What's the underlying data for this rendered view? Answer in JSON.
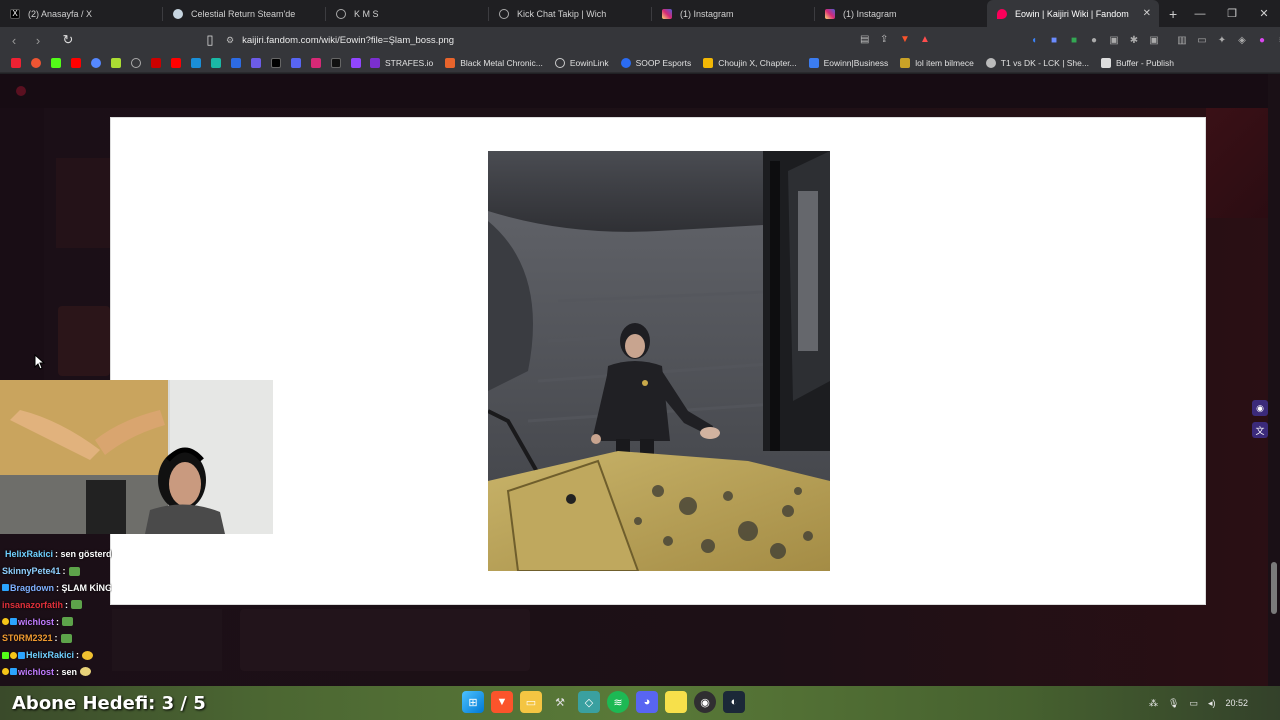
{
  "browser": {
    "tabs": [
      {
        "label": "(2) Anasayfa / X",
        "icon": "x-logo-icon",
        "color": "#000000"
      },
      {
        "label": "Celestial Return Steam'de",
        "icon": "steam-icon",
        "color": "#1b2838"
      },
      {
        "label": "K M S",
        "icon": "globe-icon",
        "color": "#888888"
      },
      {
        "label": "Kick Chat Takip | Wich",
        "icon": "globe-icon",
        "color": "#888888"
      },
      {
        "label": "(1) Instagram",
        "icon": "instagram-icon",
        "color": "#d6249f"
      },
      {
        "label": "(1) Instagram",
        "icon": "instagram-icon",
        "color": "#d6249f"
      },
      {
        "label": "Eowin | Kaijiri Wiki | Fandom",
        "icon": "fandom-icon",
        "color": "#fa005a",
        "active": true
      }
    ],
    "new_tab_glyph": "+",
    "address": "kaijiri.fandom.com/wiki/Eowin?file=Şlam_boss.png",
    "bookmarks": [
      {
        "label": "STRAFES.io",
        "color": "#7b2fd0"
      },
      {
        "label": "Black Metal Chronic...",
        "color": "#e8642c"
      },
      {
        "label": "EowinLink",
        "color": "#cccccc"
      },
      {
        "label": "SOOP Esports",
        "color": "#2b6cf2"
      },
      {
        "label": "Choujin X, Chapter...",
        "color": "#f2b705"
      },
      {
        "label": "Eowinn|Business",
        "color": "#3b7cf0"
      },
      {
        "label": "lol item bilmece",
        "color": "#c9a227"
      },
      {
        "label": "T1 vs DK - LCK | She...",
        "color": "#cccccc"
      },
      {
        "label": "Buffer - Publish",
        "color": "#dddddd"
      }
    ]
  },
  "chat": {
    "lines": [
      {
        "user": "HelixRakici",
        "user_color": "#6fd0ff",
        "message": ": sen gösterdin"
      },
      {
        "user": "SkinnyPete41",
        "user_color": "#8fd0ff",
        "message": ":"
      },
      {
        "user": "Bragdown",
        "user_color": "#7fb0ff",
        "message": ": ŞLAM KİNG"
      },
      {
        "user": "insanazorfatih",
        "user_color": "#e0303a",
        "message": ":"
      },
      {
        "user": "wichlost",
        "user_color": "#c07bff",
        "message": ":"
      },
      {
        "user": "ST0RM2321",
        "user_color": "#f09a30",
        "message": ":"
      },
      {
        "user": "HelixRakici",
        "user_color": "#6fd0ff",
        "message": ":"
      },
      {
        "user": "wichlost",
        "user_color": "#c07bff",
        "message": ": sen"
      }
    ]
  },
  "overlay": {
    "goal_text": "Abone Hedefi:  3 / 5"
  },
  "taskbar": {
    "clock": "20:52"
  },
  "colors": {
    "modal_bg": "#ffffff",
    "page_bg": "#1a1016",
    "accent": "#fa005a"
  }
}
